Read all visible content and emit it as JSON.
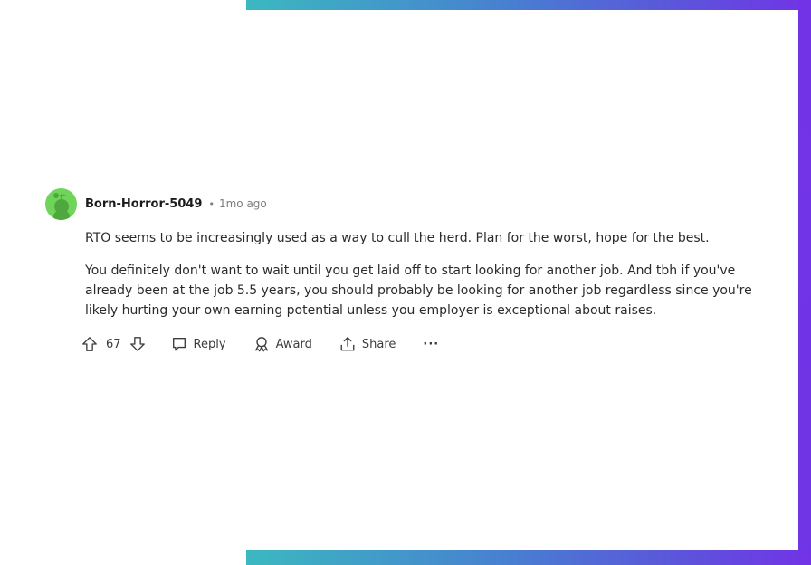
{
  "comment": {
    "author": "Born-Horror-5049",
    "separator": "•",
    "time": "1mo ago",
    "paragraphs": [
      "RTO seems to be increasingly used as a way to cull the herd. Plan for the worst, hope for the best.",
      "You definitely don't want to wait until you get laid off to start looking for another job. And tbh if you've already been at the job 5.5 years, you should probably be looking for another job regardless since you're likely hurting your own earning potential unless you employer is exceptional about raises."
    ],
    "vote_count": "67",
    "actions": {
      "reply": "Reply",
      "award": "Award",
      "share": "Share",
      "more": "···"
    }
  },
  "colors": {
    "gradient_start": "#3cb8c0",
    "gradient_end": "#7233e6",
    "avatar_bg": "#6fd45a"
  }
}
